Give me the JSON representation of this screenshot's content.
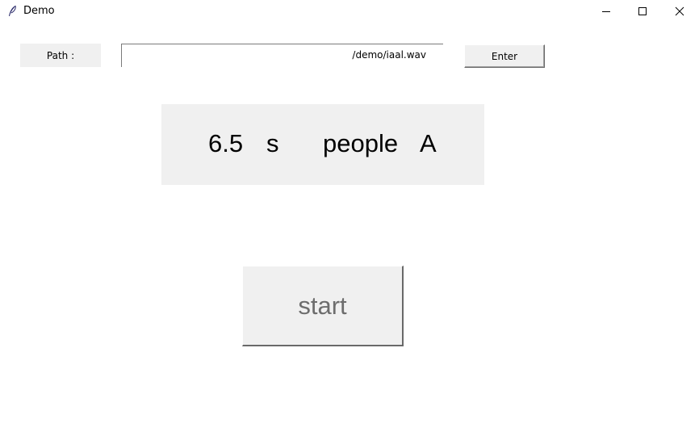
{
  "window": {
    "title": "Demo",
    "icons": {
      "app": "feather-icon",
      "minimize": "minimize-icon",
      "maximize": "maximize-icon",
      "close": "close-icon"
    }
  },
  "path_row": {
    "label": "Path :",
    "input_value": "/demo/iaal.wav",
    "enter_label": "Enter"
  },
  "result": {
    "time": "6.5",
    "unit": "s",
    "people": "people",
    "speaker": "A"
  },
  "start_label": "start",
  "colors": {
    "panel_bg": "#f0f0f0",
    "start_text": "#6d6d6d"
  }
}
